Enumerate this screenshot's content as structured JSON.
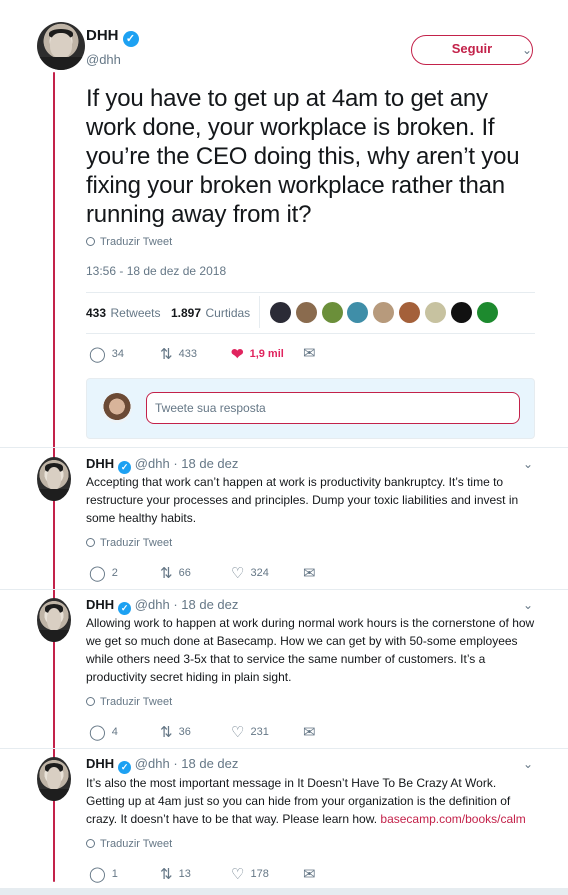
{
  "main_tweet": {
    "author_name": "DHH",
    "author_handle": "@dhh",
    "follow_label": "Seguir",
    "text": "If you have to get up at 4am to get any work done, your workplace is broken. If you’re the CEO doing this, why aren’t you fixing your broken workplace rather than running away from it?",
    "translate_label": "Traduzir Tweet",
    "timestamp": "13:56 - 18 de dez de 2018",
    "retweets_count": "433",
    "retweets_label": "Retweets",
    "likes_count": "1.897",
    "likes_label": "Curtidas",
    "actions": {
      "replies": "34",
      "retweets": "433",
      "likes": "1,9 mil"
    }
  },
  "reply_composer": {
    "placeholder": "Tweete sua resposta"
  },
  "replies": [
    {
      "author_name": "DHH",
      "author_handle": "@dhh",
      "date": "18 de dez",
      "text": "Accepting that work can’t happen at work is productivity bankruptcy. It’s time to restructure your processes and principles. Dump your toxic liabilities and invest in some healthy habits.",
      "translate_label": "Traduzir Tweet",
      "replies": "2",
      "retweets": "66",
      "likes": "324"
    },
    {
      "author_name": "DHH",
      "author_handle": "@dhh",
      "date": "18 de dez",
      "text": "Allowing work to happen at work during normal work hours is the cornerstone of how we get so much done at Basecamp. How we can get by with 50-some employees while others need 3-5x that to service the same number of customers. It’s a productivity secret hiding in plain sight.",
      "translate_label": "Traduzir Tweet",
      "replies": "4",
      "retweets": "36",
      "likes": "231"
    },
    {
      "author_name": "DHH",
      "author_handle": "@dhh",
      "date": "18 de dez",
      "text": "It’s also the most important message in It Doesn’t Have To Be Crazy At Work. Getting up at 4am just so you can hide from your organization is the definition of crazy. It doesn’t have to be that way. Please learn how.",
      "link_text": "basecamp.com/books/calm",
      "translate_label": "Traduzir Tweet",
      "replies": "1",
      "retweets": "13",
      "likes": "178"
    }
  ],
  "colors": {
    "accent": "#c3224a",
    "verified": "#1da1f2",
    "like": "#e0245e",
    "muted": "#657786"
  },
  "icons": [
    "verified-badge-icon",
    "chevron-down-icon",
    "globe-icon",
    "reply-icon",
    "retweet-icon",
    "heart-icon",
    "direct-message-icon"
  ]
}
